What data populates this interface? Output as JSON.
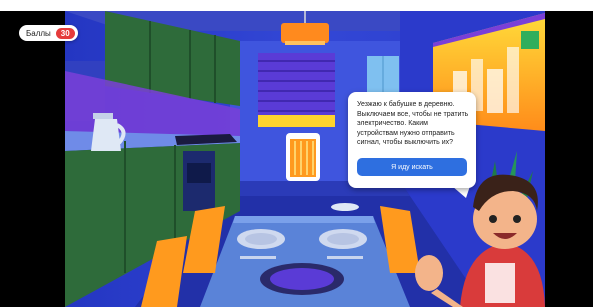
{
  "score": {
    "label": "Баллы",
    "value": "30"
  },
  "dialog": {
    "text": "Уезжаю к бабушке в деревню. Выключаем все, чтобы не тратить электричество. Каким устройствам нужно отправить сигнал, чтобы выключить их?",
    "button_label": "Я иду искать"
  },
  "colors": {
    "wall": "#2b3fcf",
    "ceiling": "#3a49c4",
    "cabinet": "#2e6b3a",
    "window": "#f5c400",
    "button": "#2e6fe0",
    "score_badge": "#e53b3b"
  },
  "icons": [
    "kettle-icon",
    "lamp-icon",
    "heater-icon",
    "tv-icon",
    "plate-icon"
  ]
}
